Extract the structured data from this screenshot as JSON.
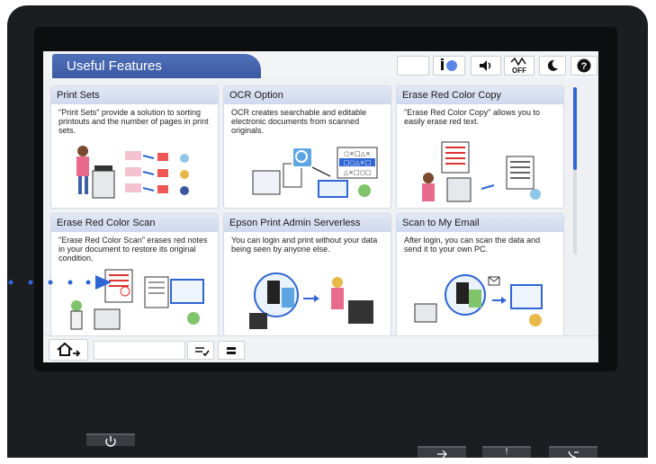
{
  "header": {
    "title": "Useful Features",
    "toolbar": {
      "info_icon": "info-icon",
      "volume_icon": "volume-icon",
      "sound_off_label": "OFF",
      "sleep_icon": "moon-icon",
      "help_icon": "help-icon"
    }
  },
  "features": [
    {
      "title": "Print Sets",
      "description": "\"Print Sets\" provide a solution to sorting printouts and the number of pages in print sets."
    },
    {
      "title": "OCR Option",
      "description": "OCR creates searchable and editable electronic documents from scanned originals."
    },
    {
      "title": "Erase Red Color Copy",
      "description": "\"Erase Red Color Copy\" allows you to easily erase red text."
    },
    {
      "title": "Erase Red Color Scan",
      "description": "\"Erase Red Color Scan\" erases red notes in your document to restore its original condition."
    },
    {
      "title": "Epson Print Admin Serverless",
      "description": "You can login and print without your data being seen by anyone else."
    },
    {
      "title": "Scan to My Email",
      "description": "After login, you can scan the data and send it to your own PC."
    }
  ],
  "ocr_illustration_text": [
    "○×□△×",
    "□○△×□",
    "△×□○□"
  ],
  "bottom_bar": {
    "home_icon": "home-icon",
    "job_status_icon": "job-status-icon",
    "printer_icon": "printer-status-icon"
  },
  "hardware": {
    "power_icon": "power-icon",
    "data_icon": "data-icon",
    "error_label": "!",
    "fax_icon": "fax-icon"
  },
  "colors": {
    "accent": "#3c5aa3",
    "scroll": "#2f66d4",
    "card_header": "#d8e1f2"
  }
}
